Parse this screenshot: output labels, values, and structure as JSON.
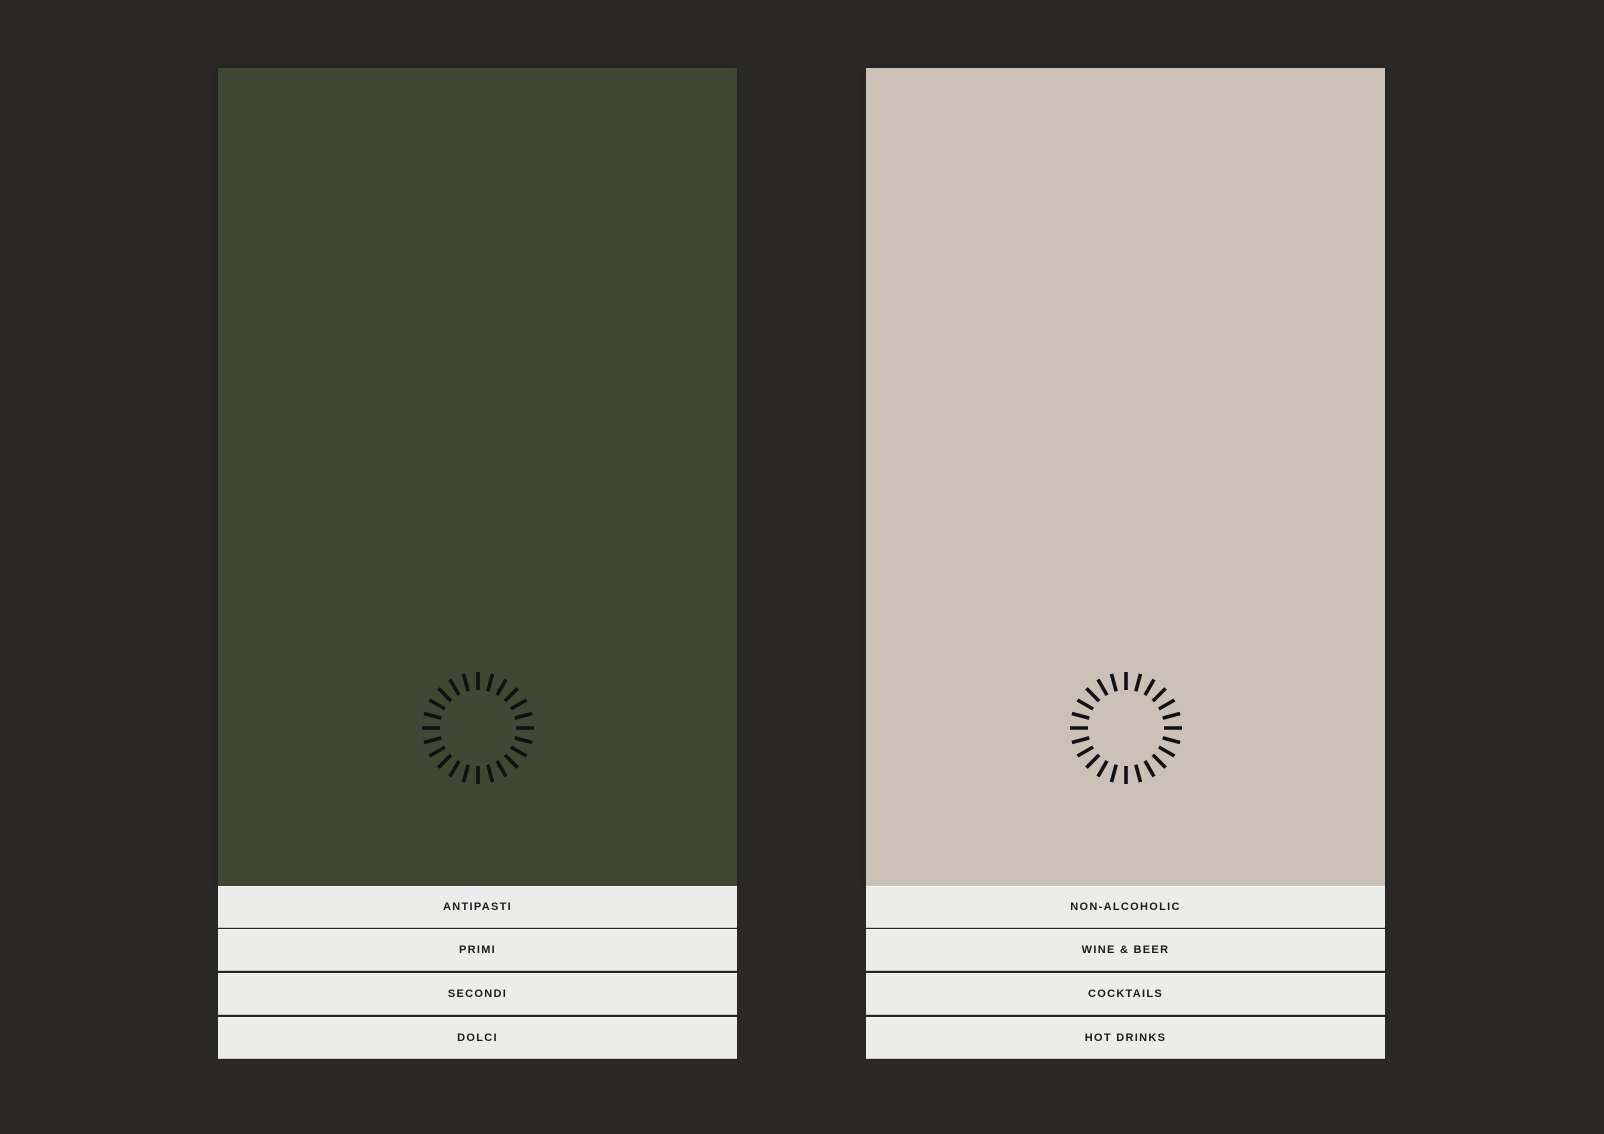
{
  "colors": {
    "background": "#2a2927",
    "food_cover": "#414735",
    "drinks_cover": "#cbc1b6",
    "tab": "#ececea",
    "emblem": "#111111"
  },
  "emblem": {
    "icon": "sun-ring-logo-icon"
  },
  "food_menu": {
    "tabs": [
      "ANTIPASTI",
      "PRIMI",
      "SECONDI",
      "DOLCI"
    ]
  },
  "drinks_menu": {
    "tabs": [
      "NON-ALCOHOLIC",
      "WINE & BEER",
      "COCKTAILS",
      "HOT DRINKS"
    ]
  }
}
